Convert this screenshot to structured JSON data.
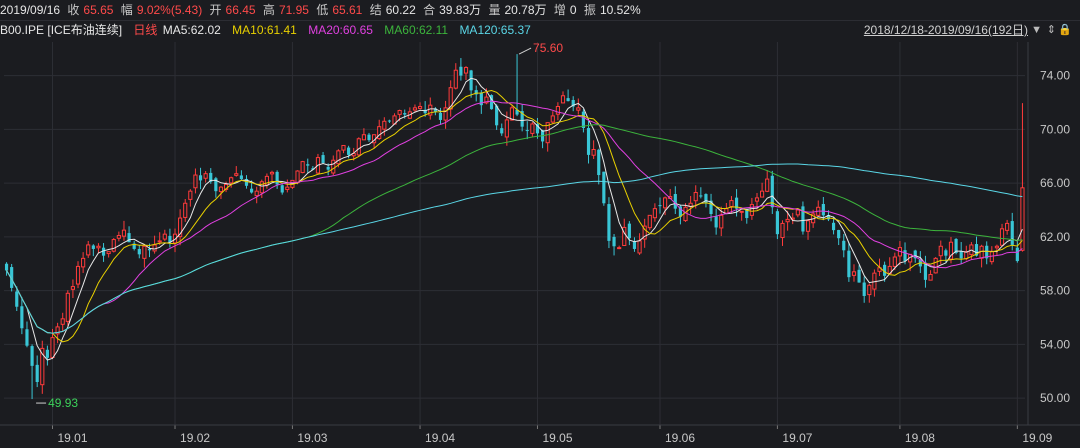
{
  "header": {
    "date": "2019/09/16",
    "close_label": "收",
    "close_value": "65.65",
    "change_label": "幅",
    "change_value": "9.02%(5.43)",
    "open_label": "开",
    "open_value": "66.45",
    "high_label": "高",
    "high_value": "71.95",
    "low_label": "低",
    "low_value": "65.61",
    "settle_label": "结",
    "settle_value": "60.22",
    "hold_label": "合",
    "hold_value": "39.83万",
    "volume_label": "量",
    "volume_value": "20.78万",
    "add_label": "增",
    "add_value": "0",
    "amp_label": "振",
    "amp_value": "10.52%"
  },
  "legend": {
    "symbol": "B00.IPE [ICE布油连续]",
    "period": "日线",
    "ma5": "MA5:62.02",
    "ma10": "MA10:61.41",
    "ma20": "MA20:60.65",
    "ma60": "MA60:62.11",
    "ma120": "MA120:65.37",
    "range": "2018/12/18-2019/09/16(192日)",
    "dropdown_icon": "▼",
    "settings_icon": "⇕",
    "lock_icon": "🔒"
  },
  "colors": {
    "up": "#ff3b3b",
    "down": "#39c6d6",
    "ma5": "#e8e8e8",
    "ma10": "#e8d000",
    "ma20": "#e040e0",
    "ma60": "#3cb43c",
    "ma120": "#5ad6e6",
    "grid": "#2d2e34"
  },
  "chart_data": {
    "type": "candlestick",
    "ylim": [
      48,
      76.5
    ],
    "yticks": [
      "50.00",
      "54.00",
      "58.00",
      "62.00",
      "66.00",
      "70.00",
      "74.00"
    ],
    "xticks": [
      {
        "label": "19.01",
        "index": 9
      },
      {
        "label": "19.02",
        "index": 33
      },
      {
        "label": "19.03",
        "index": 56
      },
      {
        "label": "19.04",
        "index": 81
      },
      {
        "label": "19.05",
        "index": 104
      },
      {
        "label": "19.06",
        "index": 128
      },
      {
        "label": "19.07",
        "index": 151
      },
      {
        "label": "19.08",
        "index": 175
      },
      {
        "label": "19.09",
        "index": 198
      }
    ],
    "high_annotation": {
      "label": "75.60",
      "index": 100,
      "value": 75.6
    },
    "low_annotation": {
      "label": "49.93",
      "index": 5,
      "value": 49.93
    },
    "close_series": [
      59.5,
      58.2,
      56.8,
      55.2,
      53.9,
      52.4,
      51.2,
      53.7,
      53.0,
      54.5,
      55.3,
      55.9,
      57.8,
      58.3,
      59.8,
      60.4,
      61.4,
      61.1,
      61.3,
      60.6,
      60.9,
      61.8,
      62.1,
      62.5,
      61.6,
      61.1,
      60.7,
      61.3,
      61.0,
      61.4,
      61.7,
      62.2,
      61.6,
      62.2,
      63.4,
      64.5,
      65.4,
      66.6,
      66.2,
      66.7,
      66.1,
      65.4,
      65.7,
      65.9,
      66.4,
      66.7,
      66.3,
      65.8,
      65.3,
      65.4,
      66.1,
      66.5,
      66.8,
      65.9,
      65.3,
      65.7,
      66.2,
      66.9,
      67.6,
      67.3,
      67.0,
      67.9,
      67.5,
      67.0,
      67.7,
      68.4,
      68.8,
      68.1,
      68.2,
      69.3,
      69.6,
      69.2,
      69.6,
      70.2,
      70.6,
      70.6,
      71.0,
      71.4,
      71.1,
      71.3,
      71.6,
      71.7,
      71.2,
      71.8,
      71.3,
      70.7,
      71.6,
      73.1,
      74.4,
      74.0,
      74.6,
      72.9,
      72.6,
      71.8,
      72.4,
      71.5,
      70.3,
      69.7,
      70.7,
      71.6,
      71.1,
      70.2,
      69.9,
      70.4,
      69.7,
      69.1,
      70.5,
      71.0,
      71.7,
      72.5,
      72.1,
      71.7,
      71.6,
      70.1,
      68.1,
      68.5,
      66.6,
      64.5,
      61.7,
      61.3,
      61.2,
      62.7,
      61.9,
      61.1,
      61.7,
      62.8,
      63.6,
      64.1,
      64.3,
      64.9,
      65.0,
      64.1,
      63.5,
      64.2,
      64.5,
      65.3,
      65.0,
      64.5,
      63.7,
      62.7,
      63.6,
      64.1,
      64.7,
      64.1,
      63.9,
      63.4,
      64.4,
      64.9,
      65.4,
      66.3,
      64.2,
      62.2,
      63.0,
      63.3,
      63.4,
      64.0,
      62.4,
      63.2,
      63.7,
      64.2,
      63.6,
      63.3,
      62.5,
      61.9,
      61.0,
      59.0,
      59.4,
      58.6,
      57.6,
      58.4,
      59.3,
      59.7,
      59.1,
      59.8,
      60.5,
      61.2,
      60.2,
      60.7,
      60.4,
      59.8,
      58.8,
      59.2,
      60.4,
      61.3,
      60.6,
      61.6,
      60.8,
      60.4,
      60.9,
      61.4,
      60.6,
      61.3,
      60.4,
      60.9,
      61.3,
      62.6,
      63.0,
      61.4,
      60.2,
      65.65
    ],
    "ma5": "MA5:62.02",
    "ma10": "MA10:61.41",
    "ma20": "MA20:60.65",
    "ma60": "MA60:62.11",
    "ma120": "MA120:65.37"
  }
}
